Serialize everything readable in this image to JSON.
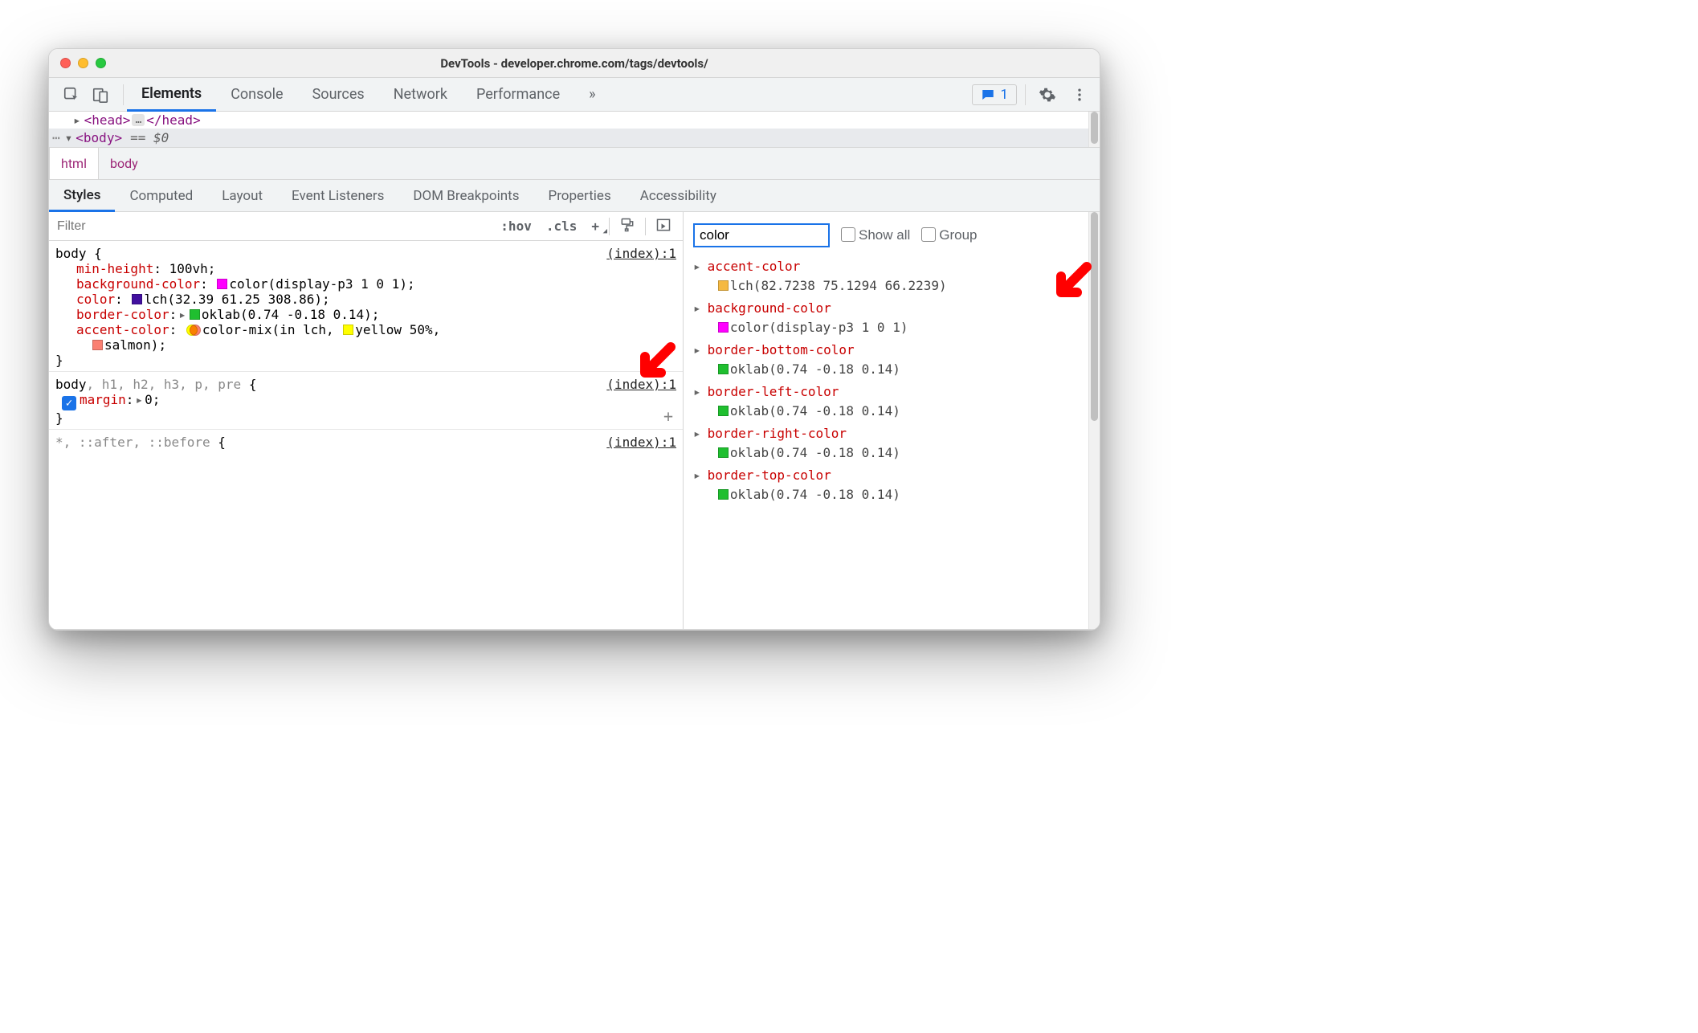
{
  "window": {
    "title": "DevTools - developer.chrome.com/tags/devtools/"
  },
  "main_tabs": {
    "items": [
      "Elements",
      "Console",
      "Sources",
      "Network",
      "Performance"
    ],
    "overflow": "»",
    "active": "Elements"
  },
  "issues": {
    "count": "1"
  },
  "dom": {
    "head": {
      "open": "<head>",
      "close": "</head>",
      "ellipsis": "…"
    },
    "body": {
      "open": "<body>",
      "eq": "== $0"
    }
  },
  "breadcrumb": {
    "items": [
      "html",
      "body"
    ]
  },
  "sub_tabs": {
    "items": [
      "Styles",
      "Computed",
      "Layout",
      "Event Listeners",
      "DOM Breakpoints",
      "Properties",
      "Accessibility"
    ],
    "active": "Styles"
  },
  "styles_toolbar": {
    "filter_placeholder": "Filter",
    "hov": ":hov",
    "cls": ".cls"
  },
  "rules": [
    {
      "selector": "body",
      "source": "(index):1",
      "declarations": [
        {
          "prop": "min-height",
          "value": "100vh"
        },
        {
          "prop": "background-color",
          "value": "color(display-p3 1 0 1)",
          "swatch": "#ff00ff"
        },
        {
          "prop": "color",
          "value": "lch(32.39 61.25 308.86)",
          "swatch": "#42109f"
        },
        {
          "prop": "border-color",
          "value": "oklab(0.74 -0.18 0.14)",
          "swatch": "#1fbf2f",
          "expand": true
        },
        {
          "prop": "accent-color",
          "value_parts": {
            "prefix": "color-mix(in lch, ",
            "first_color": "yellow",
            "first_pct": "50%",
            "second_color": "salmon",
            "suffix": ")"
          },
          "yellow_swatch": "#ffff00",
          "salmon_swatch": "#fa8072"
        }
      ]
    },
    {
      "selector_primary": "body",
      "selector_rest": ", h1, h2, h3, p, pre",
      "source": "(index):1",
      "margin_prop": "margin",
      "margin_val": "0"
    },
    {
      "selector": "*, ::after, ::before",
      "source": "(index):1"
    }
  ],
  "computed": {
    "filter_value": "color",
    "show_all_label": "Show all",
    "group_label": "Group",
    "items": [
      {
        "prop": "accent-color",
        "value": "lch(82.7238 75.1294 66.2239)",
        "swatch": "#f5b942"
      },
      {
        "prop": "background-color",
        "value": "color(display-p3 1 0 1)",
        "swatch": "#ff00ff"
      },
      {
        "prop": "border-bottom-color",
        "value": "oklab(0.74 -0.18 0.14)",
        "swatch": "#1fbf2f"
      },
      {
        "prop": "border-left-color",
        "value": "oklab(0.74 -0.18 0.14)",
        "swatch": "#1fbf2f"
      },
      {
        "prop": "border-right-color",
        "value": "oklab(0.74 -0.18 0.14)",
        "swatch": "#1fbf2f"
      },
      {
        "prop": "border-top-color",
        "value": "oklab(0.74 -0.18 0.14)",
        "swatch": "#1fbf2f"
      }
    ]
  }
}
